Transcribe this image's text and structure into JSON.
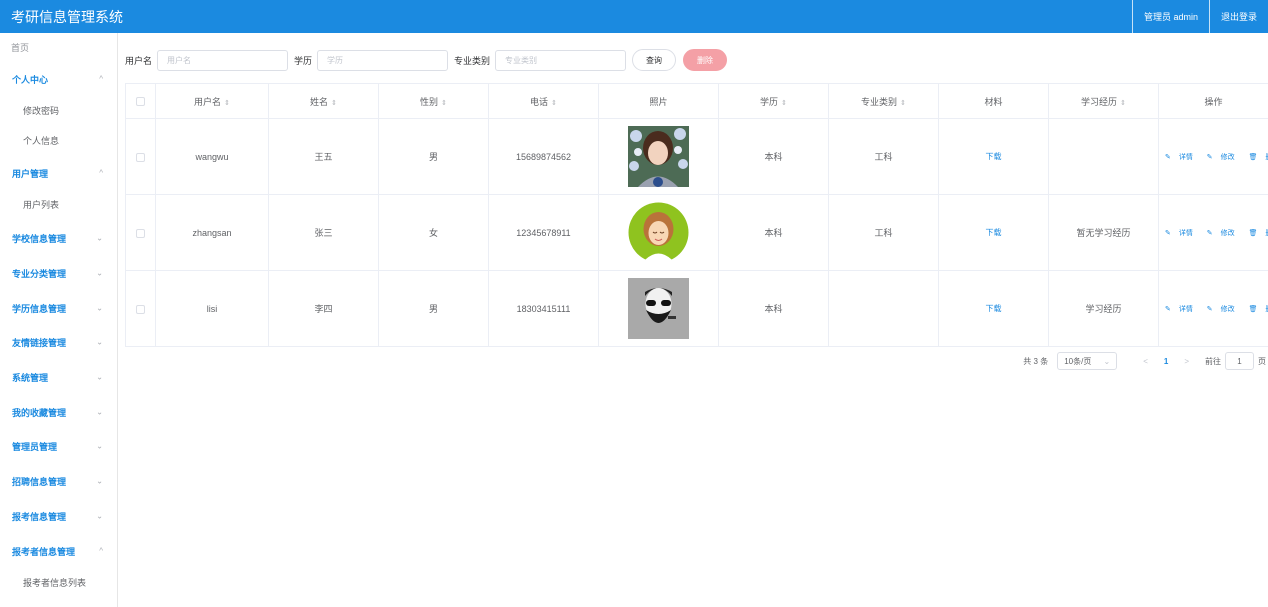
{
  "header": {
    "title": "考研信息管理系统",
    "admin": "管理员 admin",
    "logout": "退出登录",
    "bg_color": "#1b8ae0"
  },
  "sidebar": {
    "home": "首页",
    "groups": [
      {
        "label": "个人中心",
        "expanded": true,
        "items": [
          "修改密码",
          "个人信息"
        ]
      },
      {
        "label": "用户管理",
        "expanded": true,
        "items": [
          "用户列表"
        ]
      },
      {
        "label": "学校信息管理",
        "expanded": false,
        "items": []
      },
      {
        "label": "专业分类管理",
        "expanded": false,
        "items": []
      },
      {
        "label": "学历信息管理",
        "expanded": false,
        "items": []
      },
      {
        "label": "友情链接管理",
        "expanded": false,
        "items": []
      },
      {
        "label": "系统管理",
        "expanded": false,
        "items": []
      },
      {
        "label": "我的收藏管理",
        "expanded": false,
        "items": []
      },
      {
        "label": "管理员管理",
        "expanded": false,
        "items": []
      },
      {
        "label": "招聘信息管理",
        "expanded": false,
        "items": []
      },
      {
        "label": "报考信息管理",
        "expanded": false,
        "items": []
      },
      {
        "label": "报考者信息管理",
        "expanded": true,
        "items": [
          "报考者信息列表"
        ]
      }
    ],
    "chevron_up": "^",
    "chevron_down": "⌄"
  },
  "search": {
    "username_label": "用户名",
    "username_placeholder": "用户名",
    "education_label": "学历",
    "education_placeholder": "学历",
    "major_label": "专业类别",
    "major_placeholder": "专业类别",
    "query_button": "查询",
    "delete_button": "删除",
    "delete_color": "#f4a0a6"
  },
  "table": {
    "headers": [
      "用户名",
      "姓名",
      "性别",
      "电话",
      "照片",
      "学历",
      "专业类别",
      "材料",
      "学习经历",
      "操作"
    ],
    "sort_glyph": "⇕",
    "rows": [
      {
        "username": "wangwu",
        "name": "王五",
        "gender": "男",
        "phone": "15689874562",
        "photo": "avatar-girl-flowers",
        "education": "本科",
        "major": "工科",
        "material": "下载",
        "experience": ""
      },
      {
        "username": "zhangsan",
        "name": "张三",
        "gender": "女",
        "phone": "12345678911",
        "photo": "avatar-cartoon-woman",
        "education": "本科",
        "major": "工科",
        "material": "下载",
        "experience": "暂无学习经历"
      },
      {
        "username": "lisi",
        "name": "李四",
        "gender": "男",
        "phone": "18303415111",
        "photo": "avatar-bearded-man",
        "education": "本科",
        "major": "",
        "material": "下载",
        "experience": "学习经历"
      }
    ],
    "ops": {
      "detail": "详情",
      "edit": "修改",
      "delete": "删除"
    },
    "ops_icons": {
      "detail": "✎",
      "edit": "✎",
      "delete": "🗑"
    }
  },
  "pagination": {
    "total": "共 3 条",
    "page_size": "10条/页",
    "prev": "<",
    "current_page": "1",
    "next": ">",
    "goto_label": "前往",
    "goto_value": "1",
    "page_suffix": "页"
  }
}
